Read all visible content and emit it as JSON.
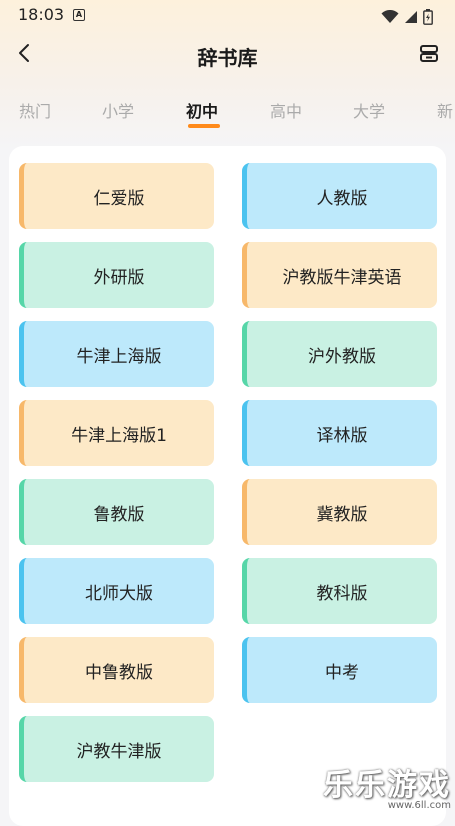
{
  "status_bar": {
    "time": "18:03",
    "a_badge": "A"
  },
  "header": {
    "title": "辞书库"
  },
  "tabs": [
    {
      "label": "热门"
    },
    {
      "label": "小学"
    },
    {
      "label": "初中"
    },
    {
      "label": "高中"
    },
    {
      "label": "大学"
    },
    {
      "label": "新"
    }
  ],
  "active_tab": "初中",
  "accent_color": "#ff8a1a",
  "books": [
    {
      "label": "仁爱版",
      "color": "orange"
    },
    {
      "label": "人教版",
      "color": "blue"
    },
    {
      "label": "外研版",
      "color": "green"
    },
    {
      "label": "沪教版牛津英语",
      "color": "orange"
    },
    {
      "label": "牛津上海版",
      "color": "blue"
    },
    {
      "label": "沪外教版",
      "color": "green"
    },
    {
      "label": "牛津上海版1",
      "color": "orange"
    },
    {
      "label": "译林版",
      "color": "blue"
    },
    {
      "label": "鲁教版",
      "color": "green"
    },
    {
      "label": "冀教版",
      "color": "orange"
    },
    {
      "label": "北师大版",
      "color": "blue"
    },
    {
      "label": "教科版",
      "color": "green"
    },
    {
      "label": "中鲁教版",
      "color": "orange"
    },
    {
      "label": "中考",
      "color": "blue"
    },
    {
      "label": "沪教牛津版",
      "color": "green"
    }
  ],
  "watermark": {
    "text": "乐乐游戏",
    "url": "www.6ll.com"
  }
}
